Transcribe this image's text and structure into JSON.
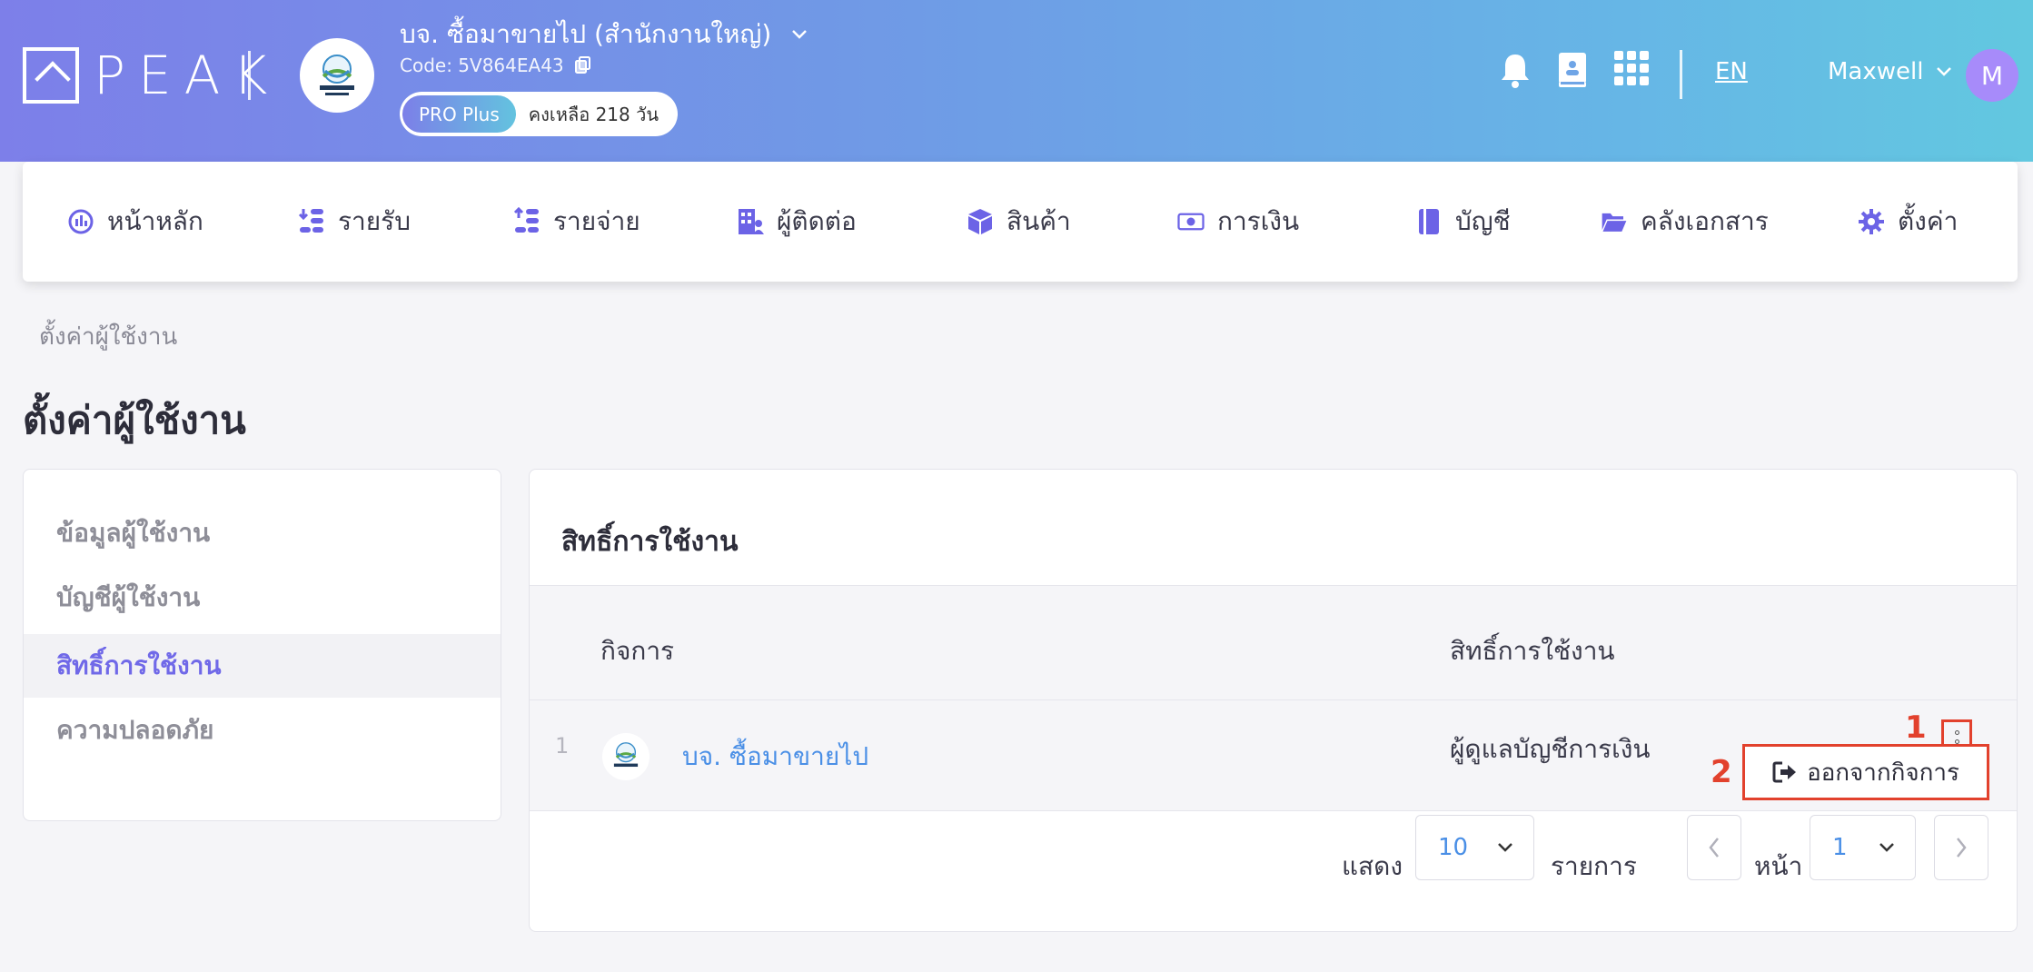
{
  "header": {
    "logo_text": "PEAK",
    "company_name": "บจ. ซื้อมาขายไป (สำนักงานใหญ่)",
    "company_code": "Code: 5V864EA43",
    "plan_name": "PRO Plus",
    "plan_remaining": "คงเหลือ 218 วัน",
    "language": "EN",
    "user_name": "Maxwell",
    "user_initial": "M",
    "icons": [
      "bell-icon",
      "book-icon",
      "apps-grid-icon"
    ]
  },
  "nav": {
    "items": [
      {
        "label": "หน้าหลัก",
        "icon": "dashboard-icon"
      },
      {
        "label": "รายรับ",
        "icon": "income-icon"
      },
      {
        "label": "รายจ่าย",
        "icon": "expense-icon"
      },
      {
        "label": "ผู้ติดต่อ",
        "icon": "contacts-icon"
      },
      {
        "label": "สินค้า",
        "icon": "box-icon"
      },
      {
        "label": "การเงิน",
        "icon": "money-icon"
      },
      {
        "label": "บัญชี",
        "icon": "ledger-icon"
      },
      {
        "label": "คลังเอกสาร",
        "icon": "folder-icon"
      },
      {
        "label": "ตั้งค่า",
        "icon": "gear-icon"
      }
    ]
  },
  "breadcrumb": "ตั้งค่าผู้ใช้งาน",
  "page_title": "ตั้งค่าผู้ใช้งาน",
  "sidebar": {
    "items": [
      {
        "label": "ข้อมูลผู้ใช้งาน",
        "active": false
      },
      {
        "label": "บัญชีผู้ใช้งาน",
        "active": false
      },
      {
        "label": "สิทธิ์การใช้งาน",
        "active": true
      },
      {
        "label": "ความปลอดภัย",
        "active": false
      }
    ]
  },
  "main": {
    "title": "สิทธิ์การใช้งาน",
    "columns": [
      "กิจการ",
      "สิทธิ์การใช้งาน"
    ],
    "rows": [
      {
        "number": "1",
        "company": "บจ. ซื้อมาขายไป",
        "role": "ผู้ดูแลบัญชีการเงิน"
      }
    ],
    "row_menu": {
      "leave_label": "ออกจากกิจการ"
    },
    "markers": [
      "1",
      "2"
    ],
    "pagination": {
      "show_label": "แสดง",
      "page_size": "10",
      "items_label": "รายการ",
      "page_label": "หน้า",
      "current_page": "1"
    }
  },
  "colors": {
    "accent": "#7069e8",
    "link": "#4a8fe6",
    "annotation": "#e2412d",
    "header_gradient_start": "#7d7fe9",
    "header_gradient_end": "#62c8e0"
  }
}
